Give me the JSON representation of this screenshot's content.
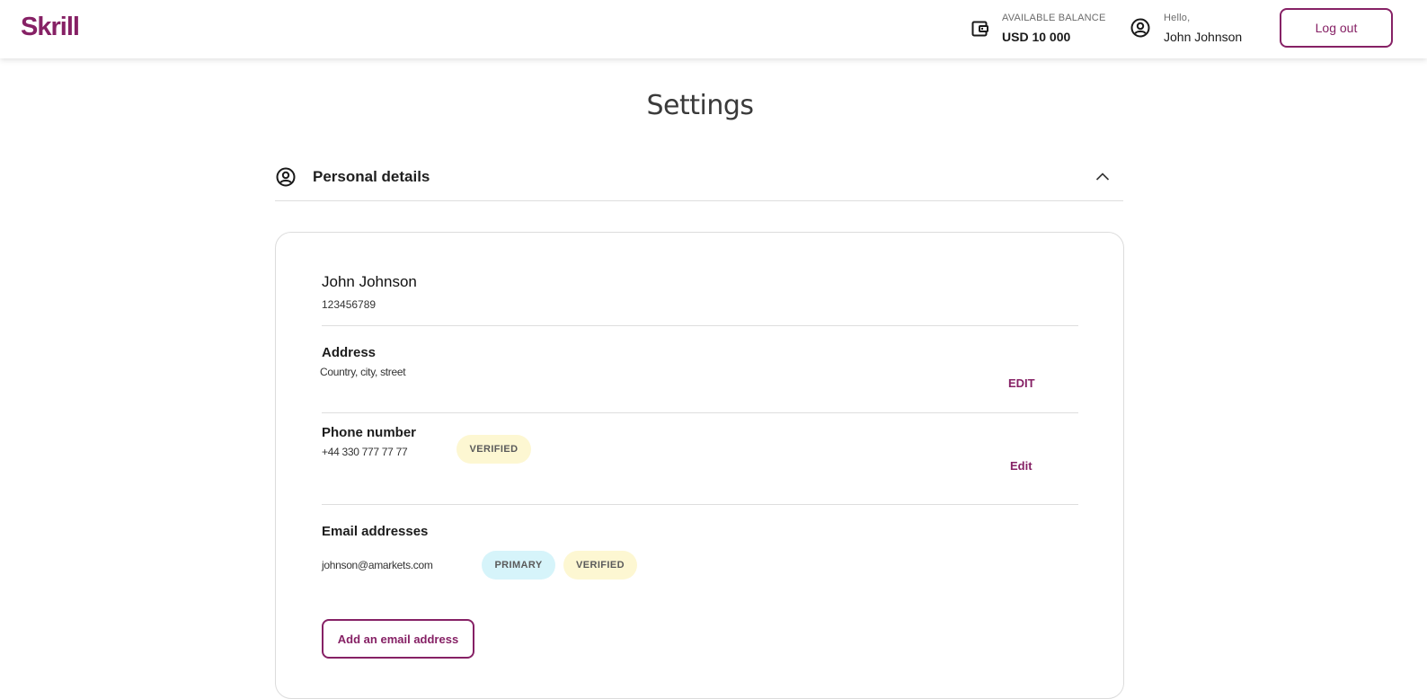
{
  "header": {
    "logo": "Skrill",
    "balance_label": "AVAILABLE BALANCE",
    "balance_value": "USD 10 000",
    "greeting": "Hello,",
    "user_name": "John Johnson",
    "logout_label": "Log out",
    "icons": {
      "wallet": "wallet-icon",
      "user": "user-circle-icon"
    }
  },
  "page": {
    "title": "Settings"
  },
  "section": {
    "title": "Personal details",
    "icon": "user-circle-icon",
    "expanded": true
  },
  "profile": {
    "name": "John Johnson",
    "account_number": "123456789"
  },
  "address": {
    "title": "Address",
    "value": "Country, city, street",
    "edit_label": "EDIT"
  },
  "phone": {
    "title": "Phone number",
    "value": "+44 330 777 77 77",
    "badge": "VERIFIED",
    "edit_label": "Edit"
  },
  "email": {
    "title": "Email addresses",
    "value": "johnson@amarkets.com",
    "badge_primary": "PRIMARY",
    "badge_verified": "VERIFIED",
    "add_label": "Add an email address"
  },
  "colors": {
    "brand": "#862165",
    "badge_verified_bg": "#fdf7d2",
    "badge_primary_bg": "#d6f4fa"
  }
}
